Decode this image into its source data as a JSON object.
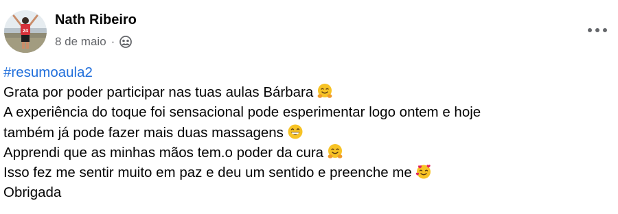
{
  "post": {
    "author": "Nath Ribeiro",
    "date": "8 de maio",
    "separator": "·",
    "privacy_icon": "friends-icon",
    "more_icon": "more-options-icon",
    "hashtag": "#resumoaula2",
    "lines": [
      {
        "text": "Grata por poder participar nas tuas aulas Bárbara",
        "emoji": "hugging-face"
      },
      {
        "text": "A experiência do toque foi sensacional pode esperimentar logo ontem e hoje",
        "emoji": null
      },
      {
        "text": "também já pode fazer mais duas massagens",
        "emoji": "grinning-face"
      },
      {
        "text": "Apprendi que as minhas mãos tem.o poder da cura",
        "emoji": "hugging-face"
      },
      {
        "text": "Isso fez me sentir muito em paz e deu um sentido e preenche me",
        "emoji": "smiling-face-with-hearts"
      },
      {
        "text": "Obrigada",
        "emoji": null
      }
    ],
    "avatar_jersey_number": "24"
  },
  "colors": {
    "text": "#050505",
    "secondary_text": "#65676b",
    "hashtag": "#216fdb",
    "emoji_yellow": "#f7c325",
    "heart_red": "#e0245e"
  }
}
